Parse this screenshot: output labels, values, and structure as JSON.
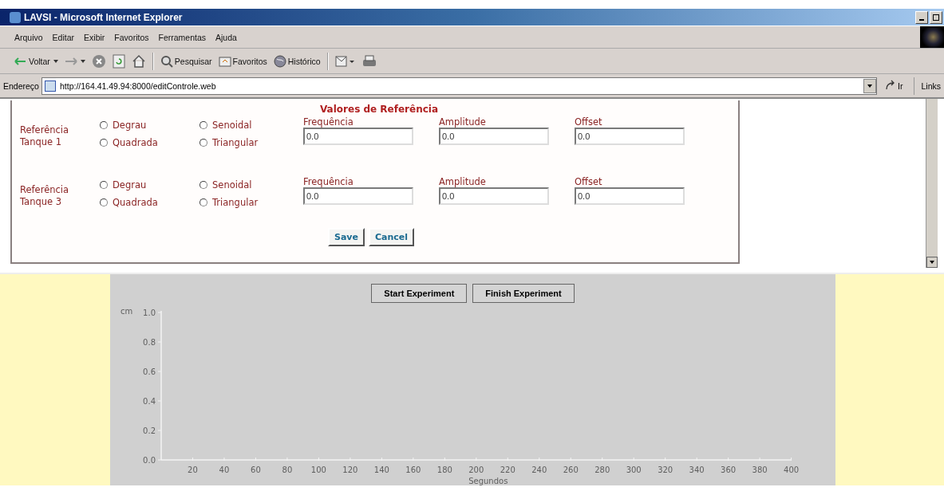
{
  "window": {
    "title": "LAVSI - Microsoft Internet Explorer"
  },
  "menu": [
    "Arquivo",
    "Editar",
    "Exibir",
    "Favoritos",
    "Ferramentas",
    "Ajuda"
  ],
  "toolbar": [
    {
      "kind": "back",
      "label": "Voltar"
    },
    {
      "kind": "forward"
    },
    {
      "kind": "stop"
    },
    {
      "kind": "refresh"
    },
    {
      "kind": "home"
    },
    {
      "kind": "search",
      "label": "Pesquisar"
    },
    {
      "kind": "favorites",
      "label": "Favoritos"
    },
    {
      "kind": "history",
      "label": "Histórico"
    },
    {
      "kind": "mail"
    },
    {
      "kind": "print"
    }
  ],
  "address": {
    "label": "Endereço",
    "value": "http://164.41.49.94:8000/editControle.web",
    "go": "Ir",
    "links": "Links"
  },
  "form": {
    "title": "Valores de Referência",
    "rows": [
      {
        "label": "Referência Tanque 1",
        "options": [
          {
            "label": "Degrau",
            "selected": false
          },
          {
            "label": "Senoidal",
            "selected": false
          },
          {
            "label": "Quadrada",
            "selected": false
          },
          {
            "label": "Triangular",
            "selected": false
          }
        ],
        "fields": [
          {
            "label": "Frequência",
            "value": "0.0"
          },
          {
            "label": "Amplitude",
            "value": "0.0"
          },
          {
            "label": "Offset",
            "value": "0.0"
          }
        ]
      },
      {
        "label": "Referência Tanque 3",
        "options": [
          {
            "label": "Degrau",
            "selected": false
          },
          {
            "label": "Senoidal",
            "selected": false
          },
          {
            "label": "Quadrada",
            "selected": false
          },
          {
            "label": "Triangular",
            "selected": false
          }
        ],
        "fields": [
          {
            "label": "Frequência",
            "value": "0.0"
          },
          {
            "label": "Amplitude",
            "value": "0.0"
          },
          {
            "label": "Offset",
            "value": "0.0"
          }
        ]
      }
    ],
    "buttons": [
      "Save",
      "Cancel"
    ]
  },
  "experiment": {
    "buttons": [
      "Start Experiment",
      "Finish Experiment"
    ],
    "chart_data": {
      "type": "line",
      "xlabel": "Segundos",
      "ylabel": "cm",
      "xlim": [
        0,
        400
      ],
      "ylim": [
        0,
        1
      ],
      "xticks": [
        20,
        40,
        60,
        80,
        100,
        120,
        140,
        160,
        180,
        200,
        220,
        240,
        260,
        280,
        300,
        320,
        340,
        360,
        380,
        400
      ],
      "yticks": [
        {
          "value": 0,
          "label": "0.0"
        },
        {
          "value": 0.2,
          "label": "0.2"
        },
        {
          "value": 0.4,
          "label": "0.4"
        },
        {
          "value": 0.6,
          "label": "0.6"
        },
        {
          "value": 0.8,
          "label": "0.8"
        },
        {
          "value": 1,
          "label": "1.0"
        }
      ]
    }
  }
}
